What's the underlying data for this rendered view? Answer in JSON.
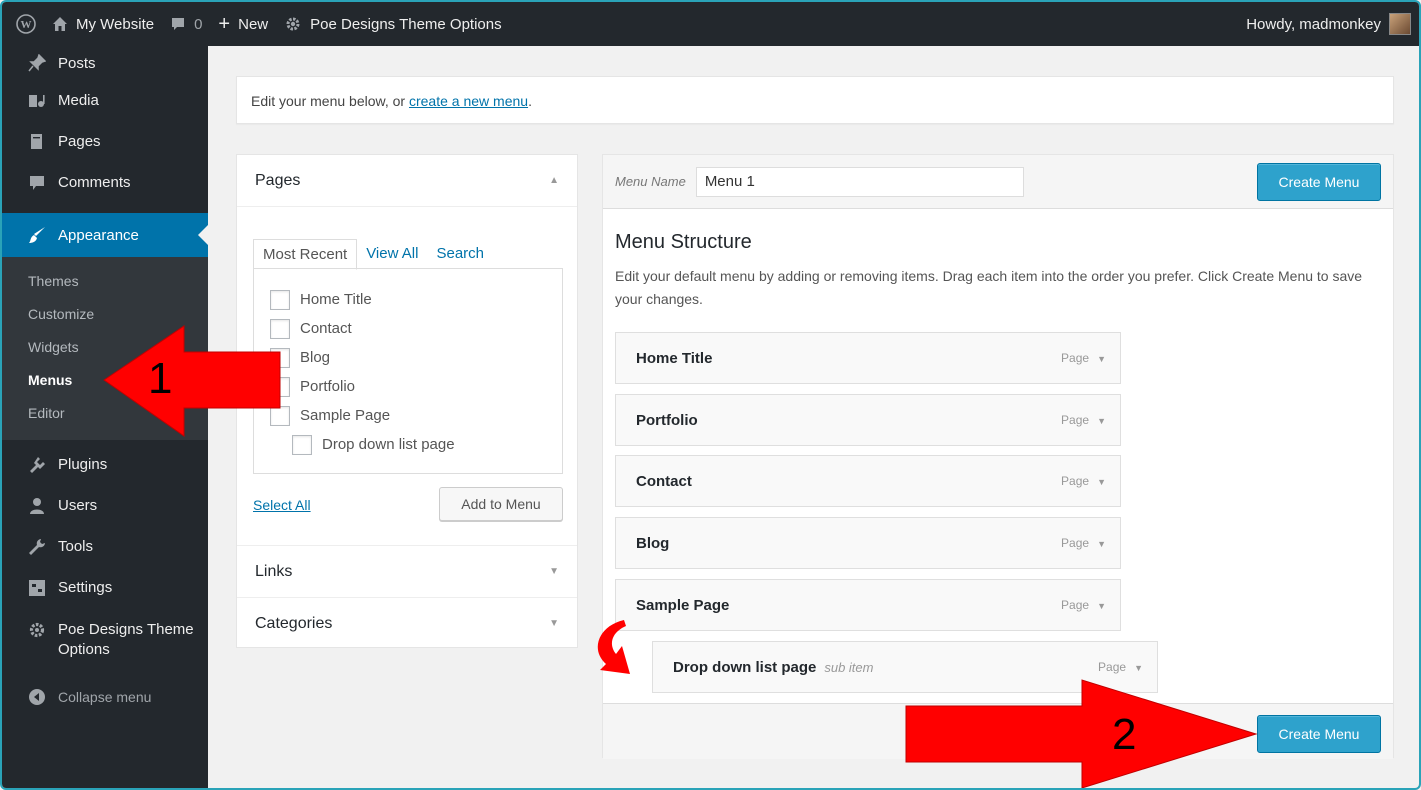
{
  "adminbar": {
    "site_name": "My Website",
    "comments_count": "0",
    "new_label": "New",
    "theme_options": "Poe Designs Theme Options",
    "howdy": "Howdy, madmonkey"
  },
  "sidebar": {
    "items": [
      {
        "label": "Posts",
        "icon": "pin-icon"
      },
      {
        "label": "Media",
        "icon": "media-icon"
      },
      {
        "label": "Pages",
        "icon": "pages-icon"
      },
      {
        "label": "Comments",
        "icon": "comment-icon"
      },
      {
        "label": "Appearance",
        "icon": "brush-icon"
      }
    ],
    "submenu": [
      "Themes",
      "Customize",
      "Widgets",
      "Menus",
      "Editor"
    ],
    "items_after": [
      {
        "label": "Plugins",
        "icon": "plugin-icon"
      },
      {
        "label": "Users",
        "icon": "users-icon"
      },
      {
        "label": "Tools",
        "icon": "wrench-icon"
      },
      {
        "label": "Settings",
        "icon": "settings-icon"
      }
    ],
    "poe_line1": "Poe Designs Theme",
    "poe_line2": "Options",
    "collapse": "Collapse menu"
  },
  "notice": {
    "text": "Edit your menu below, or ",
    "link": "create a new menu",
    "end": "."
  },
  "left_panel": {
    "pages_title": "Pages",
    "tabs": [
      "Most Recent",
      "View All",
      "Search"
    ],
    "pages": [
      "Home Title",
      "Contact",
      "Blog",
      "Portfolio",
      "Sample Page"
    ],
    "child_page": "Drop down list page",
    "select_all": "Select All",
    "add_to_menu": "Add to Menu",
    "links_title": "Links",
    "categories_title": "Categories"
  },
  "right_panel": {
    "menu_name_label": "Menu Name",
    "menu_name_value": "Menu 1",
    "create_menu": "Create Menu",
    "structure_title": "Menu Structure",
    "structure_desc": "Edit your default menu by adding or removing items. Drag each item into the order you prefer. Click Create Menu to save your changes.",
    "menu_items": [
      "Home Title",
      "Portfolio",
      "Contact",
      "Blog",
      "Sample Page"
    ],
    "item_type": "Page",
    "sub_item_title": "Drop down list page",
    "sub_item_label": "sub item"
  },
  "annotations": {
    "one": "1",
    "two": "2"
  },
  "colors": {
    "accent": "#0073aa",
    "primary_button": "#2ea2cc",
    "annotation": "#ff0000"
  }
}
